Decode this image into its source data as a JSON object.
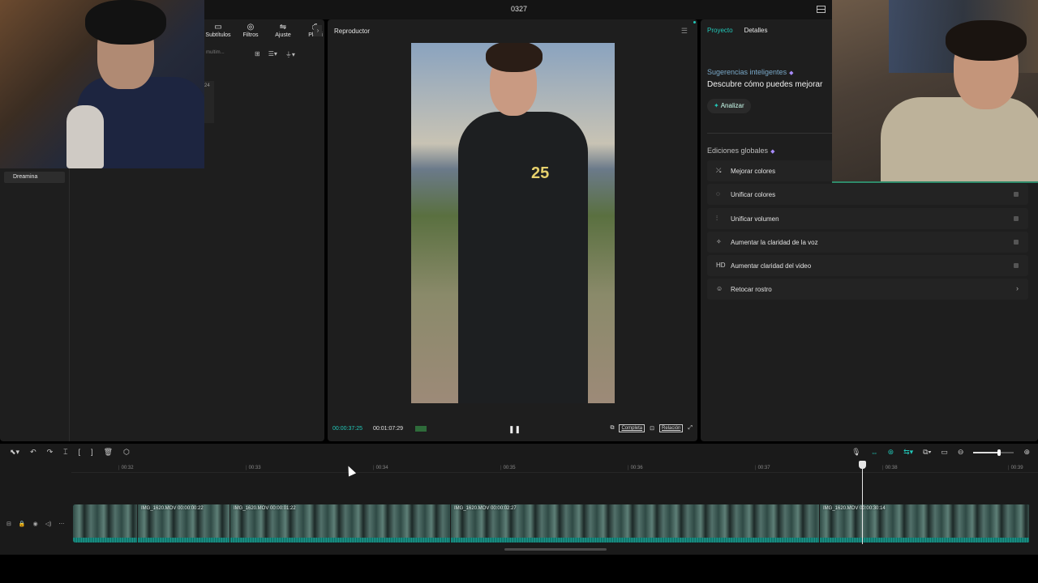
{
  "window": {
    "title": "0327"
  },
  "media_toolbar": {
    "tools": [
      {
        "label": "Subtítulos",
        "icon": "▭"
      },
      {
        "label": "Filtros",
        "icon": "◎"
      },
      {
        "label": "Ajuste",
        "icon": "⇋"
      },
      {
        "label": "Planti",
        "icon": "⎙"
      }
    ],
    "more": "›",
    "search_placeholder": "multim...",
    "badge": "24"
  },
  "sidebar": {
    "items": [
      {
        "label": "Dreamina"
      }
    ]
  },
  "player": {
    "title": "Reproductor",
    "current_time": "00:00:37:25",
    "total_time": "00:01:07:29",
    "full_label": "Completa",
    "ratio_label": "Relación"
  },
  "right_panel": {
    "tabs": [
      {
        "label": "Proyecto"
      },
      {
        "label": "Detalles"
      }
    ],
    "suggestions_title": "Sugerencias inteligentes",
    "suggestions_text": "Descubre cómo puedes mejorar",
    "analyze_label": "Analizar",
    "global_title": "Ediciones globales",
    "edits": [
      {
        "label": "Mejorar colores",
        "icon": "⤯"
      },
      {
        "label": "Unificar colores",
        "icon": "◌"
      },
      {
        "label": "Unificar volumen",
        "icon": "⫶"
      },
      {
        "label": "Aumentar la claridad de la voz",
        "icon": "✧"
      },
      {
        "label": "Aumentar claridad del video",
        "icon": "HD"
      },
      {
        "label": "Retocar rostro",
        "icon": "☺"
      }
    ]
  },
  "timeline": {
    "ticks": [
      "00:32",
      "00:33",
      "00:34",
      "00:35",
      "00:36",
      "00:37",
      "00:38",
      "00:39"
    ],
    "clips": [
      {
        "label": ""
      },
      {
        "label": "IMG_1620.MOV  00:00:00:22"
      },
      {
        "label": "IMG_1620.MOV  00:00:01:22"
      },
      {
        "label": "IMG_1620.MOV  00:00:02:27"
      },
      {
        "label": "IMG_1620.MOV  00:00:30:14"
      }
    ]
  },
  "colors": {
    "accent": "#22c7b8",
    "panel": "#1e1e1e",
    "clip": "#0f6e67"
  }
}
